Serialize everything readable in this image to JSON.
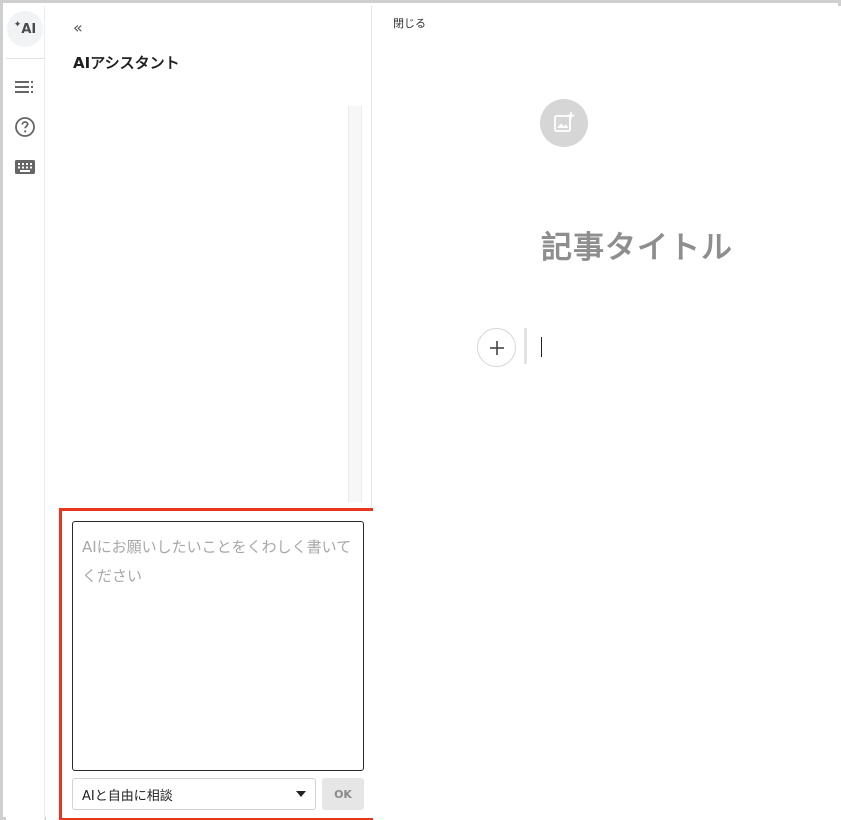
{
  "rail": {
    "ai_label": "AI",
    "icons": [
      "ai-assistant-icon",
      "outline-list-icon",
      "help-circle-icon",
      "keyboard-icon"
    ]
  },
  "panel": {
    "collapse_icon": "double-chevron-left-icon",
    "title": "AIアシスタント",
    "input_placeholder": "AIにお願いしたいことをくわしく書いてください",
    "mode_select_value": "AIと自由に相談",
    "ok_label": "OK"
  },
  "editor": {
    "close_label": "閉じる",
    "add_image_icon": "add-image-icon",
    "title_placeholder": "記事タイトル",
    "add_block_icon": "plus-icon"
  },
  "colors": {
    "highlight_border": "#e8361c",
    "title_gray": "#8e8e8e"
  }
}
